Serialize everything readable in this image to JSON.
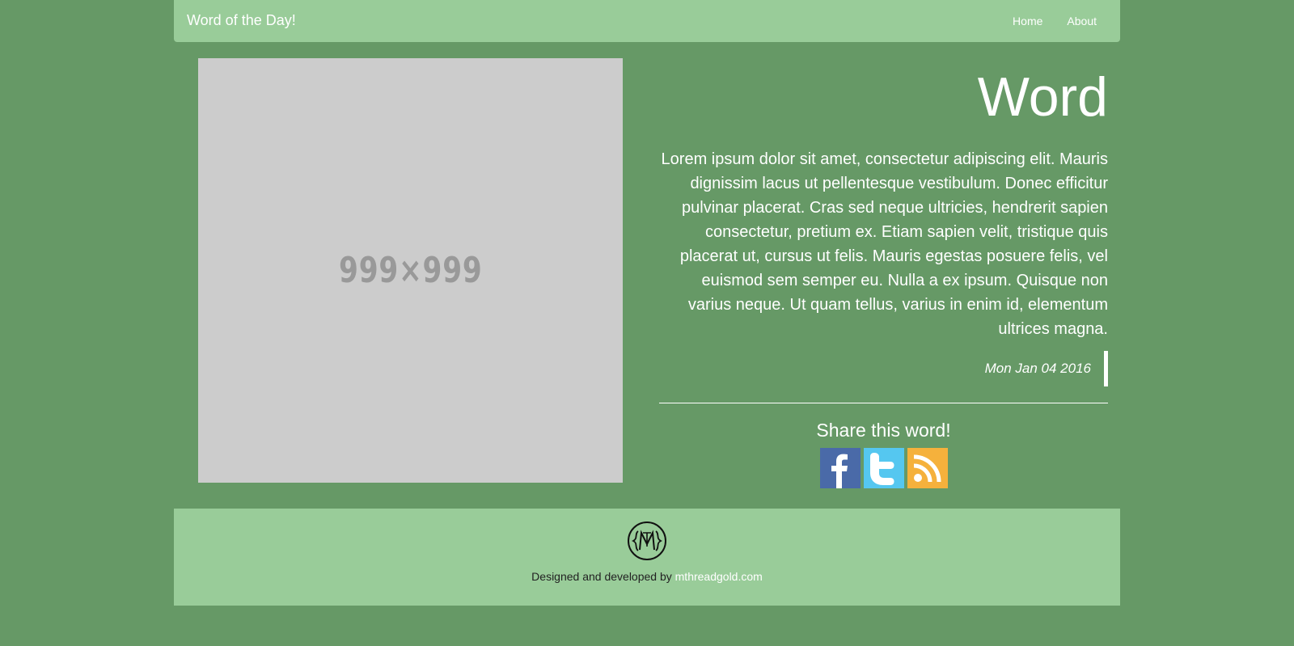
{
  "navbar": {
    "brand": "Word of the Day!",
    "links": [
      {
        "label": "Home"
      },
      {
        "label": "About"
      }
    ]
  },
  "image_placeholder": {
    "label": "999×999"
  },
  "word": {
    "title": "Word",
    "definition": "Lorem ipsum dolor sit amet, consectetur adipiscing elit. Mauris dignissim lacus ut pellentesque vestibulum. Donec efficitur pulvinar placerat. Cras sed neque ultricies, hendrerit sapien consectetur, pretium ex. Etiam sapien velit, tristique quis placerat ut, cursus ut felis. Mauris egestas posuere felis, vel euismod sem semper eu. Nulla a ex ipsum. Quisque non varius neque. Ut quam tellus, varius in enim id, elementum ultrices magna.",
    "date": "Mon Jan 04 2016"
  },
  "share": {
    "title": "Share this word!",
    "icons": [
      "facebook-icon",
      "twitter-icon",
      "rss-icon"
    ]
  },
  "footer": {
    "credit_prefix": "Designed and developed by ",
    "credit_link": "mthreadgold.com"
  },
  "colors": {
    "background": "#669966",
    "navbar": "#99cc99",
    "placeholder": "#cccccc",
    "facebook": "#3b5998",
    "twitter": "#55c7f0",
    "rss": "#f5b13c"
  }
}
